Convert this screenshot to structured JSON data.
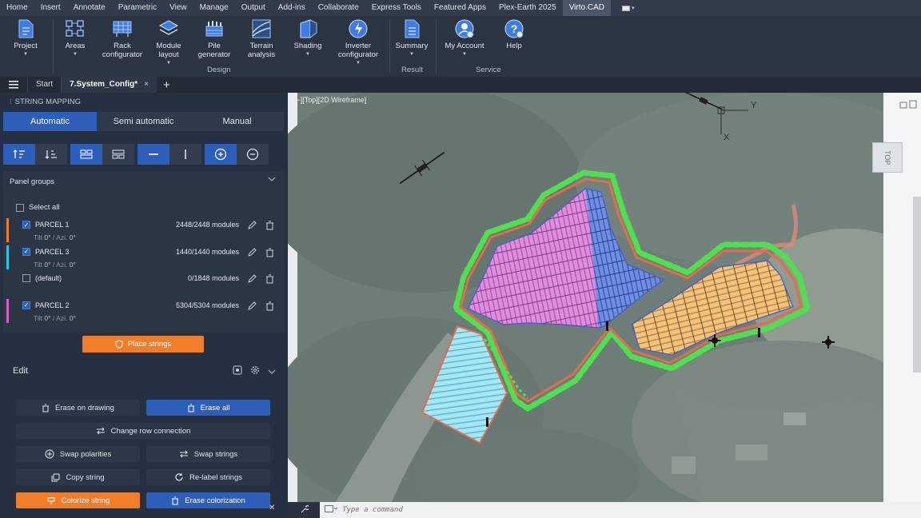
{
  "menu": {
    "tabs": [
      "Home",
      "Insert",
      "Annotate",
      "Parametric",
      "View",
      "Manage",
      "Output",
      "Add-ins",
      "Collaborate",
      "Express Tools",
      "Featured Apps",
      "Plex-Earth 2025",
      "Virto.CAD"
    ],
    "active_tab": "Virto.CAD"
  },
  "ribbon": {
    "buttons": [
      {
        "id": "project",
        "label1": "Project",
        "label2": "",
        "caret": true,
        "icon": "document-icon"
      },
      {
        "id": "areas",
        "label1": "Areas",
        "label2": "",
        "caret": true,
        "icon": "areas-icon"
      },
      {
        "id": "rack",
        "label1": "Rack",
        "label2": "configurator",
        "caret": false,
        "icon": "rack-icon"
      },
      {
        "id": "module",
        "label1": "Module",
        "label2": "layout",
        "caret": true,
        "icon": "layers-icon"
      },
      {
        "id": "pile",
        "label1": "Pile",
        "label2": "generator",
        "caret": false,
        "icon": "pile-icon"
      },
      {
        "id": "terrain",
        "label1": "Terrain",
        "label2": "analysis",
        "caret": false,
        "icon": "terrain-icon"
      },
      {
        "id": "shading",
        "label1": "Shading",
        "label2": "",
        "caret": true,
        "icon": "shading-icon"
      },
      {
        "id": "inverter",
        "label1": "Inverter",
        "label2": "configurator",
        "caret": true,
        "icon": "inverter-icon"
      },
      {
        "id": "summary",
        "label1": "Summary",
        "label2": "",
        "caret": true,
        "icon": "summary-icon"
      },
      {
        "id": "account",
        "label1": "My Account",
        "label2": "",
        "caret": true,
        "icon": "account-icon"
      },
      {
        "id": "help",
        "label1": "Help",
        "label2": "",
        "caret": false,
        "icon": "help-icon"
      }
    ],
    "groups": {
      "design": "Design",
      "result": "Result",
      "service": "Service"
    }
  },
  "doc_tabs": {
    "start": "Start",
    "active": "7.System_Config*",
    "close": "×",
    "add": "+"
  },
  "panel": {
    "title": "STRING MAPPING",
    "modes": [
      "Automatic",
      "Semi automatic",
      "Manual"
    ],
    "active_mode": "Automatic",
    "groups_header": "Panel groups",
    "select_all": "Select all",
    "groups": [
      {
        "name": "PARCEL 1",
        "checked": true,
        "color": "#f07d2a",
        "modules": "2448/2448 modules",
        "tilt_label": "Tilt",
        "tilt": "0°",
        "azi_label": "/ Azi.",
        "azi": "0°"
      },
      {
        "name": "PARCEL 3",
        "checked": true,
        "color": "#2ec6e8",
        "modules": "1440/1440 modules",
        "tilt_label": "Tilt",
        "tilt": "0°",
        "azi_label": "/ Azi.",
        "azi": "0°"
      },
      {
        "name": "(default)",
        "checked": false,
        "color": "",
        "modules": "0/1848 modules",
        "tilt_label": "",
        "tilt": "",
        "azi_label": "",
        "azi": ""
      },
      {
        "name": "PARCEL 2",
        "checked": true,
        "color": "#d45bc8",
        "modules": "5304/5304 modules",
        "tilt_label": "Tilt",
        "tilt": "0°",
        "azi_label": "/ Azi.",
        "azi": "0°"
      }
    ],
    "place_strings": "Place strings",
    "edit": {
      "title": "Edit",
      "erase_on_drawing": "Erase on drawing",
      "erase_all": "Erase all",
      "change_row_connection": "Change row connection",
      "swap_polarities": "Swap polarities",
      "swap_strings": "Swap strings",
      "copy_string": "Copy string",
      "relabel_strings": "Re-label strings",
      "colorize_string": "Colorize string",
      "erase_colorization": "Erase colorization"
    }
  },
  "viewport": {
    "label": "[−][Top][2D Wireframe]",
    "view_cube": "TOP",
    "axis_y": "Y",
    "axis_x": "X"
  },
  "command": {
    "placeholder": "Type a command"
  }
}
